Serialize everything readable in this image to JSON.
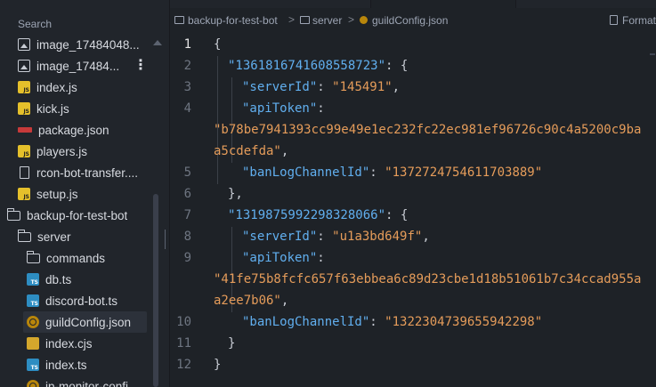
{
  "sidebar": {
    "search_label": "Search",
    "items": [
      {
        "label": "image_17484048...",
        "icon": "image-icon"
      },
      {
        "label": "image_17484...",
        "icon": "image-icon"
      },
      {
        "label": "index.js",
        "icon": "js-file-icon"
      },
      {
        "label": "kick.js",
        "icon": "js-file-icon"
      },
      {
        "label": "package.json",
        "icon": "npm-icon"
      },
      {
        "label": "players.js",
        "icon": "js-file-icon"
      },
      {
        "label": "rcon-bot-transfer....",
        "icon": "file-icon"
      },
      {
        "label": "setup.js",
        "icon": "js-file-icon"
      },
      {
        "label": "backup-for-test-bot",
        "icon": "folder-open-icon"
      },
      {
        "label": "server",
        "icon": "folder-open-icon"
      },
      {
        "label": "commands",
        "icon": "folder-icon"
      },
      {
        "label": "db.ts",
        "icon": "ts-file-icon"
      },
      {
        "label": "discord-bot.ts",
        "icon": "ts-file-icon"
      },
      {
        "label": "guildConfig.json",
        "icon": "json-config-icon",
        "selected": true
      },
      {
        "label": "index.cjs",
        "icon": "cjs-file-icon"
      },
      {
        "label": "index.ts",
        "icon": "ts-file-icon"
      },
      {
        "label": "ip-monitor-confi...",
        "icon": "json-config-icon"
      }
    ],
    "more_glyph": "⋮"
  },
  "breadcrumb": {
    "root": "backup-for-test-bot",
    "folder": "server",
    "file": "guildConfig.json",
    "separator": ">",
    "action": "Format"
  },
  "editor": {
    "lines": [
      {
        "n": "1",
        "text": "{"
      },
      {
        "n": "2",
        "key": "\"1361816741608558723\"",
        "after": ": {"
      },
      {
        "n": "3",
        "key": "\"serverId\"",
        "mid": ": ",
        "val": "\"145491\"",
        "after": ","
      },
      {
        "n": "4",
        "key": "\"apiToken\"",
        "after": ":"
      },
      {
        "n": "",
        "val": "\"b78be7941393cc99e49e1ec232fc22ec981ef96726c90c4a5200c9ba"
      },
      {
        "n": "",
        "val": "a5cdefda\"",
        "after": ","
      },
      {
        "n": "5",
        "key": "\"banLogChannelId\"",
        "mid": ": ",
        "val": "\"1372724754611703889\""
      },
      {
        "n": "6",
        "text": "},"
      },
      {
        "n": "7",
        "key": "\"1319875992298328066\"",
        "after": ": {"
      },
      {
        "n": "8",
        "key": "\"serverId\"",
        "mid": ": ",
        "val": "\"u1a3bd649f\"",
        "after": ","
      },
      {
        "n": "9",
        "key": "\"apiToken\"",
        "after": ":"
      },
      {
        "n": "",
        "val": "\"41fe75b8fcfc657f63ebbea6c89d23cbe1d18b51061b7c34ccad955a"
      },
      {
        "n": "",
        "val": "a2ee7b06\"",
        "after": ","
      },
      {
        "n": "10",
        "key": "\"banLogChannelId\"",
        "mid": ": ",
        "val": "\"1322304739655942298\""
      },
      {
        "n": "11",
        "text": "}"
      },
      {
        "n": "12",
        "text": "}"
      }
    ]
  },
  "colors": {
    "key": "#61afef",
    "string": "#e59c5a",
    "background": "#1e2227",
    "sidebar": "#21252b"
  }
}
